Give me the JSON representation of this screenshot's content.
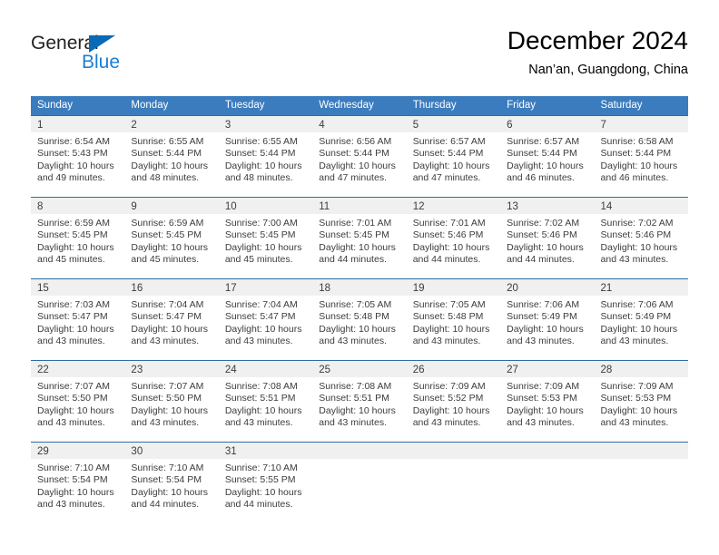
{
  "brand": {
    "name_primary": "General",
    "name_secondary": "Blue",
    "primary_color": "#231f20",
    "secondary_color": "#1a7fd4",
    "flag_color": "#0a6ab5"
  },
  "header": {
    "title": "December 2024",
    "subtitle": "Nan’an, Guangdong, China"
  },
  "theme": {
    "header_bg": "#3b7cbf",
    "header_text": "#ffffff",
    "row_divider": "#2e6da4",
    "daynum_band": "#f0f0f0",
    "text": "#3c3c3c"
  },
  "weekdays": [
    "Sunday",
    "Monday",
    "Tuesday",
    "Wednesday",
    "Thursday",
    "Friday",
    "Saturday"
  ],
  "weeks": [
    [
      {
        "day": "1",
        "sunrise": "Sunrise: 6:54 AM",
        "sunset": "Sunset: 5:43 PM",
        "daylight": "Daylight: 10 hours and 49 minutes."
      },
      {
        "day": "2",
        "sunrise": "Sunrise: 6:55 AM",
        "sunset": "Sunset: 5:44 PM",
        "daylight": "Daylight: 10 hours and 48 minutes."
      },
      {
        "day": "3",
        "sunrise": "Sunrise: 6:55 AM",
        "sunset": "Sunset: 5:44 PM",
        "daylight": "Daylight: 10 hours and 48 minutes."
      },
      {
        "day": "4",
        "sunrise": "Sunrise: 6:56 AM",
        "sunset": "Sunset: 5:44 PM",
        "daylight": "Daylight: 10 hours and 47 minutes."
      },
      {
        "day": "5",
        "sunrise": "Sunrise: 6:57 AM",
        "sunset": "Sunset: 5:44 PM",
        "daylight": "Daylight: 10 hours and 47 minutes."
      },
      {
        "day": "6",
        "sunrise": "Sunrise: 6:57 AM",
        "sunset": "Sunset: 5:44 PM",
        "daylight": "Daylight: 10 hours and 46 minutes."
      },
      {
        "day": "7",
        "sunrise": "Sunrise: 6:58 AM",
        "sunset": "Sunset: 5:44 PM",
        "daylight": "Daylight: 10 hours and 46 minutes."
      }
    ],
    [
      {
        "day": "8",
        "sunrise": "Sunrise: 6:59 AM",
        "sunset": "Sunset: 5:45 PM",
        "daylight": "Daylight: 10 hours and 45 minutes."
      },
      {
        "day": "9",
        "sunrise": "Sunrise: 6:59 AM",
        "sunset": "Sunset: 5:45 PM",
        "daylight": "Daylight: 10 hours and 45 minutes."
      },
      {
        "day": "10",
        "sunrise": "Sunrise: 7:00 AM",
        "sunset": "Sunset: 5:45 PM",
        "daylight": "Daylight: 10 hours and 45 minutes."
      },
      {
        "day": "11",
        "sunrise": "Sunrise: 7:01 AM",
        "sunset": "Sunset: 5:45 PM",
        "daylight": "Daylight: 10 hours and 44 minutes."
      },
      {
        "day": "12",
        "sunrise": "Sunrise: 7:01 AM",
        "sunset": "Sunset: 5:46 PM",
        "daylight": "Daylight: 10 hours and 44 minutes."
      },
      {
        "day": "13",
        "sunrise": "Sunrise: 7:02 AM",
        "sunset": "Sunset: 5:46 PM",
        "daylight": "Daylight: 10 hours and 44 minutes."
      },
      {
        "day": "14",
        "sunrise": "Sunrise: 7:02 AM",
        "sunset": "Sunset: 5:46 PM",
        "daylight": "Daylight: 10 hours and 43 minutes."
      }
    ],
    [
      {
        "day": "15",
        "sunrise": "Sunrise: 7:03 AM",
        "sunset": "Sunset: 5:47 PM",
        "daylight": "Daylight: 10 hours and 43 minutes."
      },
      {
        "day": "16",
        "sunrise": "Sunrise: 7:04 AM",
        "sunset": "Sunset: 5:47 PM",
        "daylight": "Daylight: 10 hours and 43 minutes."
      },
      {
        "day": "17",
        "sunrise": "Sunrise: 7:04 AM",
        "sunset": "Sunset: 5:47 PM",
        "daylight": "Daylight: 10 hours and 43 minutes."
      },
      {
        "day": "18",
        "sunrise": "Sunrise: 7:05 AM",
        "sunset": "Sunset: 5:48 PM",
        "daylight": "Daylight: 10 hours and 43 minutes."
      },
      {
        "day": "19",
        "sunrise": "Sunrise: 7:05 AM",
        "sunset": "Sunset: 5:48 PM",
        "daylight": "Daylight: 10 hours and 43 minutes."
      },
      {
        "day": "20",
        "sunrise": "Sunrise: 7:06 AM",
        "sunset": "Sunset: 5:49 PM",
        "daylight": "Daylight: 10 hours and 43 minutes."
      },
      {
        "day": "21",
        "sunrise": "Sunrise: 7:06 AM",
        "sunset": "Sunset: 5:49 PM",
        "daylight": "Daylight: 10 hours and 43 minutes."
      }
    ],
    [
      {
        "day": "22",
        "sunrise": "Sunrise: 7:07 AM",
        "sunset": "Sunset: 5:50 PM",
        "daylight": "Daylight: 10 hours and 43 minutes."
      },
      {
        "day": "23",
        "sunrise": "Sunrise: 7:07 AM",
        "sunset": "Sunset: 5:50 PM",
        "daylight": "Daylight: 10 hours and 43 minutes."
      },
      {
        "day": "24",
        "sunrise": "Sunrise: 7:08 AM",
        "sunset": "Sunset: 5:51 PM",
        "daylight": "Daylight: 10 hours and 43 minutes."
      },
      {
        "day": "25",
        "sunrise": "Sunrise: 7:08 AM",
        "sunset": "Sunset: 5:51 PM",
        "daylight": "Daylight: 10 hours and 43 minutes."
      },
      {
        "day": "26",
        "sunrise": "Sunrise: 7:09 AM",
        "sunset": "Sunset: 5:52 PM",
        "daylight": "Daylight: 10 hours and 43 minutes."
      },
      {
        "day": "27",
        "sunrise": "Sunrise: 7:09 AM",
        "sunset": "Sunset: 5:53 PM",
        "daylight": "Daylight: 10 hours and 43 minutes."
      },
      {
        "day": "28",
        "sunrise": "Sunrise: 7:09 AM",
        "sunset": "Sunset: 5:53 PM",
        "daylight": "Daylight: 10 hours and 43 minutes."
      }
    ],
    [
      {
        "day": "29",
        "sunrise": "Sunrise: 7:10 AM",
        "sunset": "Sunset: 5:54 PM",
        "daylight": "Daylight: 10 hours and 43 minutes."
      },
      {
        "day": "30",
        "sunrise": "Sunrise: 7:10 AM",
        "sunset": "Sunset: 5:54 PM",
        "daylight": "Daylight: 10 hours and 44 minutes."
      },
      {
        "day": "31",
        "sunrise": "Sunrise: 7:10 AM",
        "sunset": "Sunset: 5:55 PM",
        "daylight": "Daylight: 10 hours and 44 minutes."
      },
      {
        "day": "",
        "sunrise": "",
        "sunset": "",
        "daylight": ""
      },
      {
        "day": "",
        "sunrise": "",
        "sunset": "",
        "daylight": ""
      },
      {
        "day": "",
        "sunrise": "",
        "sunset": "",
        "daylight": ""
      },
      {
        "day": "",
        "sunrise": "",
        "sunset": "",
        "daylight": ""
      }
    ]
  ]
}
